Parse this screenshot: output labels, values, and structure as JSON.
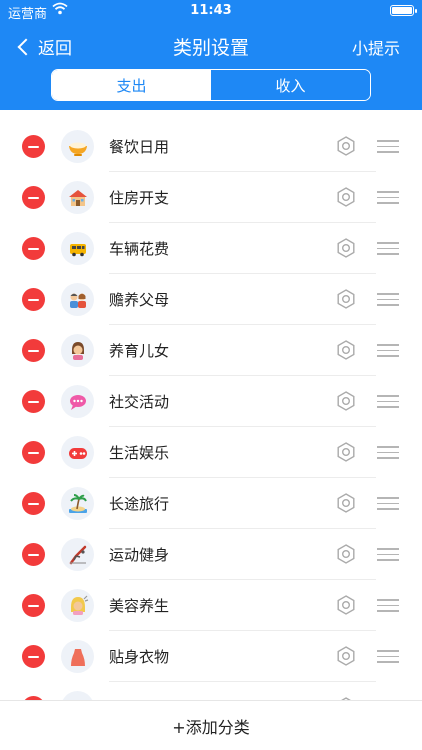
{
  "status_bar": {
    "carrier": "运营商",
    "time": "11:43"
  },
  "nav": {
    "back_label": "返回",
    "title": "类别设置",
    "hint_label": "小提示"
  },
  "tabs": [
    {
      "label": "支出",
      "active": true
    },
    {
      "label": "收入",
      "active": false
    }
  ],
  "categories": [
    {
      "label": "餐饮日用",
      "icon": "rice-bowl-icon"
    },
    {
      "label": "住房开支",
      "icon": "house-icon"
    },
    {
      "label": "车辆花费",
      "icon": "bus-icon"
    },
    {
      "label": "赡养父母",
      "icon": "parents-icon"
    },
    {
      "label": "养育儿女",
      "icon": "child-icon"
    },
    {
      "label": "社交活动",
      "icon": "chat-bubble-icon"
    },
    {
      "label": "生活娱乐",
      "icon": "gamepad-icon"
    },
    {
      "label": "长途旅行",
      "icon": "island-icon"
    },
    {
      "label": "运动健身",
      "icon": "fitness-icon"
    },
    {
      "label": "美容养生",
      "icon": "beauty-icon"
    },
    {
      "label": "贴身衣物",
      "icon": "clothing-icon"
    },
    {
      "label": "",
      "icon": "partial-icon"
    }
  ],
  "footer": {
    "add_label": "+添加分类"
  },
  "colors": {
    "primary": "#1e88f5",
    "delete": "#f23b3b"
  }
}
